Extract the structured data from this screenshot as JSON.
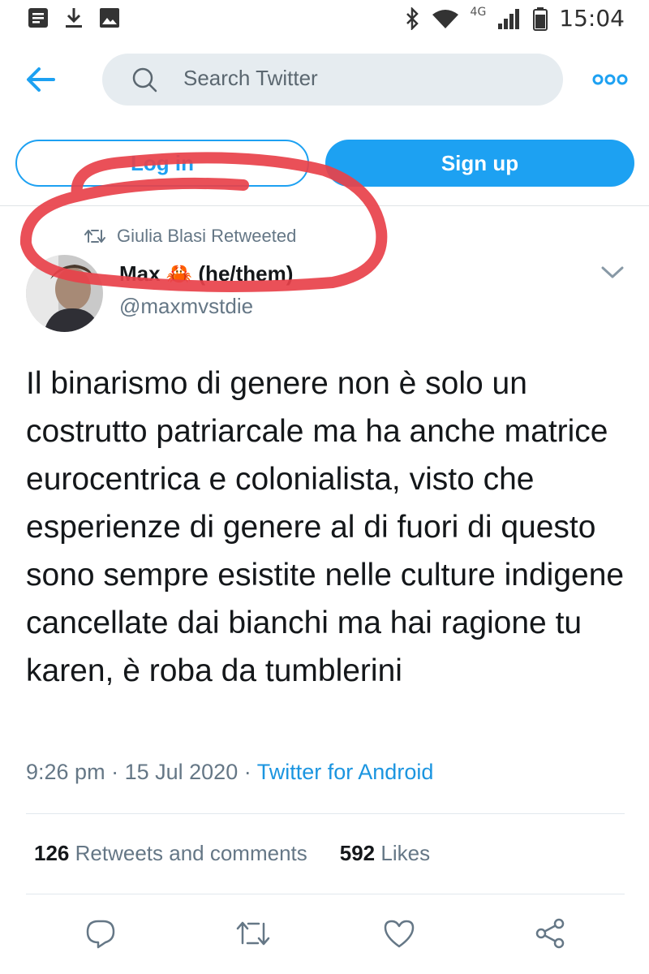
{
  "status_bar": {
    "time": "15:04",
    "network": "4G",
    "left_icons": [
      "notes-icon",
      "download-icon",
      "image-icon"
    ],
    "right_icons": [
      "bluetooth-icon",
      "wifi-icon",
      "signal-icon",
      "battery-icon"
    ]
  },
  "header": {
    "back_icon": "arrow-left-icon",
    "search_placeholder": "Search Twitter",
    "more_icon": "more-dots-icon"
  },
  "auth": {
    "login_label": "Log in",
    "signup_label": "Sign up"
  },
  "tweet": {
    "retweeted_by": "Giulia Blasi Retweeted",
    "author_name": "Max 🦀 (he/them)",
    "author_handle": "@maxmvstdie",
    "text": "Il binarismo di genere non è solo un costrutto patriarcale ma ha anche matrice eurocentrica e colonialista, visto che esperienze di genere al di fuori di questo sono sempre esistite nelle culture indigene cancellate dai bianchi ma hai ragione tu karen, è roba da tumblerini",
    "time": "9:26 pm",
    "date": "15 Jul 2020",
    "separator": "·",
    "source": "Twitter for Android",
    "retweets_count": "126",
    "retweets_label": "Retweets and comments",
    "likes_count": "592",
    "likes_label": "Likes"
  },
  "actions": [
    "reply-icon",
    "retweet-icon",
    "like-icon",
    "share-icon"
  ],
  "colors": {
    "accent": "#1da1f2",
    "link": "#1b95e0",
    "muted": "#657786",
    "annotation": "#e8414a"
  }
}
